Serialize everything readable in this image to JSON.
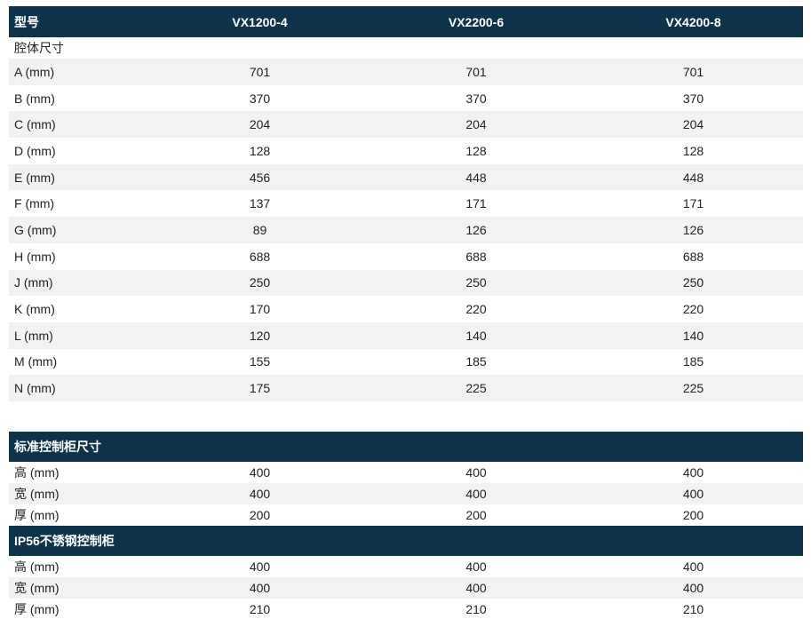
{
  "header": {
    "label": "型号",
    "columns": [
      "VX1200-4",
      "VX2200-6",
      "VX4200-8"
    ]
  },
  "chamber": {
    "title": "腔体尺寸",
    "rows": [
      {
        "label": "A (mm)",
        "values": [
          "701",
          "701",
          "701"
        ]
      },
      {
        "label": "B (mm)",
        "values": [
          "370",
          "370",
          "370"
        ]
      },
      {
        "label": "C (mm)",
        "values": [
          "204",
          "204",
          "204"
        ]
      },
      {
        "label": "D (mm)",
        "values": [
          "128",
          "128",
          "128"
        ]
      },
      {
        "label": "E (mm)",
        "values": [
          "456",
          "448",
          "448"
        ]
      },
      {
        "label": "F (mm)",
        "values": [
          "137",
          "171",
          "171"
        ]
      },
      {
        "label": "G (mm)",
        "values": [
          "89",
          "126",
          "126"
        ]
      },
      {
        "label": "H (mm)",
        "values": [
          "688",
          "688",
          "688"
        ]
      },
      {
        "label": "J (mm)",
        "values": [
          "250",
          "250",
          "250"
        ]
      },
      {
        "label": "K (mm)",
        "values": [
          "170",
          "220",
          "220"
        ]
      },
      {
        "label": "L (mm)",
        "values": [
          "120",
          "140",
          "140"
        ]
      },
      {
        "label": "M (mm)",
        "values": [
          "155",
          "185",
          "185"
        ]
      },
      {
        "label": "N (mm)",
        "values": [
          "175",
          "225",
          "225"
        ]
      }
    ]
  },
  "standard_cabinet": {
    "title": "标准控制柜尺寸",
    "rows": [
      {
        "label": "高 (mm)",
        "values": [
          "400",
          "400",
          "400"
        ]
      },
      {
        "label": "宽 (mm)",
        "values": [
          "400",
          "400",
          "400"
        ]
      },
      {
        "label": "厚 (mm)",
        "values": [
          "200",
          "200",
          "200"
        ]
      }
    ]
  },
  "ip56_cabinet": {
    "title": "IP56不锈钢控制柜",
    "rows": [
      {
        "label": "高 (mm)",
        "values": [
          "400",
          "400",
          "400"
        ]
      },
      {
        "label": "宽 (mm)",
        "values": [
          "400",
          "400",
          "400"
        ]
      },
      {
        "label": "厚 (mm)",
        "values": [
          "210",
          "210",
          "210"
        ]
      }
    ]
  },
  "colors": {
    "header_bg": "#0d3349",
    "stripe_bg": "#f2f2f2"
  }
}
